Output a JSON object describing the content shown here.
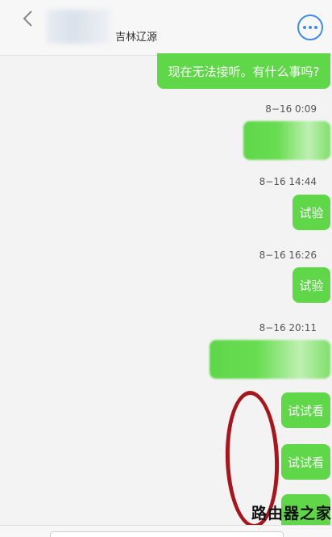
{
  "header": {
    "location": "吉林辽源"
  },
  "messages": [
    {
      "text": "现在无法接听。有什么事吗?"
    },
    {
      "timestamp": "8−16 0:09"
    },
    {
      "timestamp": "8−16 14:44",
      "text": "试验"
    },
    {
      "timestamp": "8−16 16:26",
      "text": "试验"
    },
    {
      "timestamp": "8−16 20:11"
    },
    {
      "text": "试试看"
    },
    {
      "text": "试试看"
    }
  ],
  "watermark": "路由器之家",
  "colors": {
    "bubble": "#5fd749",
    "accent": "#3f8cf0",
    "annotation": "#a8151b"
  }
}
